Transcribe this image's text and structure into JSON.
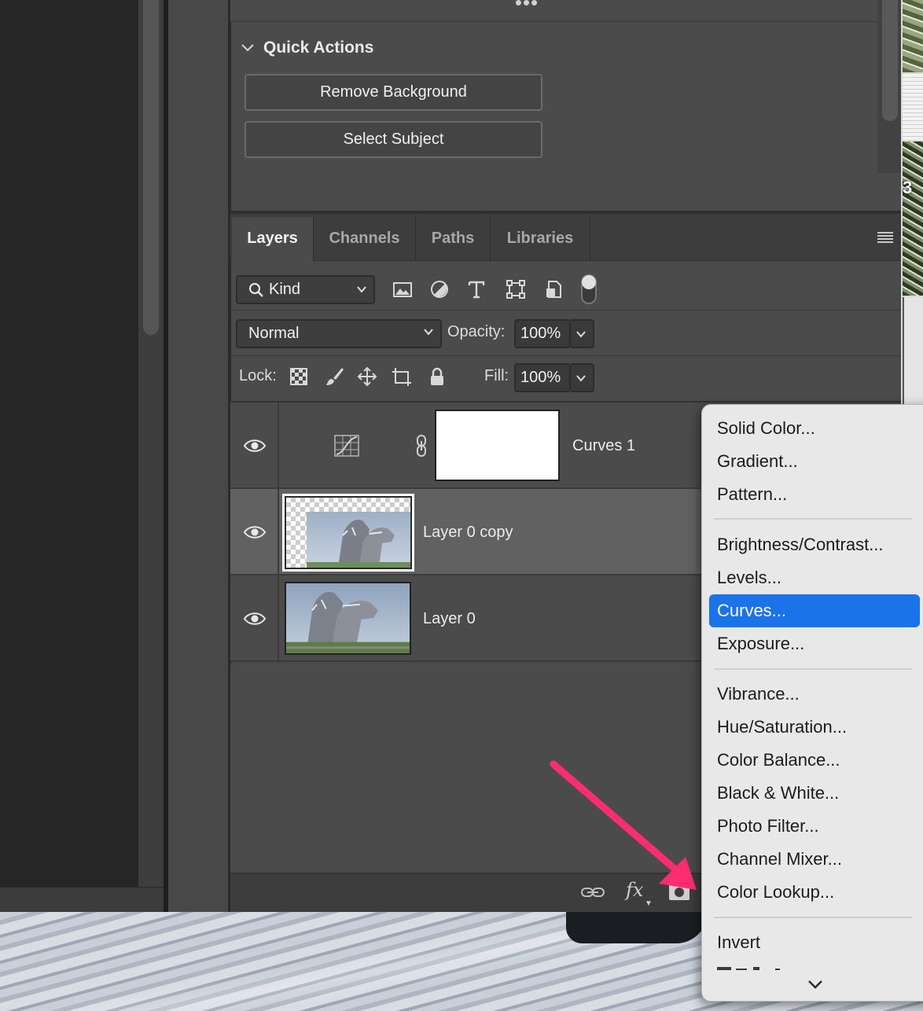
{
  "quick_actions": {
    "title": "Quick Actions",
    "buttons": [
      "Remove Background",
      "Select Subject"
    ]
  },
  "layers_panel": {
    "tabs": [
      "Layers",
      "Channels",
      "Paths",
      "Libraries"
    ],
    "active_tab": "Layers",
    "filter": {
      "kind_label": "Kind"
    },
    "blend_mode": "Normal",
    "opacity_label": "Opacity:",
    "opacity_value": "100%",
    "lock_label": "Lock:",
    "fill_label": "Fill:",
    "fill_value": "100%",
    "layers": [
      {
        "name": "Curves 1",
        "type": "adjustment",
        "visible": true
      },
      {
        "name": "Layer 0 copy",
        "type": "pixel",
        "visible": true,
        "selected": true
      },
      {
        "name": "Layer 0",
        "type": "pixel",
        "visible": true
      }
    ],
    "bottom_icons": [
      "link-icon",
      "fx-icon",
      "mask-icon"
    ]
  },
  "context_menu": {
    "items": [
      "Solid Color...",
      "Gradient...",
      "Pattern...",
      "Brightness/Contrast...",
      "Levels...",
      "Curves...",
      "Exposure...",
      "Vibrance...",
      "Hue/Saturation...",
      "Color Balance...",
      "Black & White...",
      "Photo Filter...",
      "Channel Mixer...",
      "Color Lookup...",
      "Invert"
    ],
    "highlighted": "Curves..."
  },
  "background_window": {
    "visible_number": "3"
  },
  "colors": {
    "panel": "#4b4b4b",
    "selected_row": "#616161",
    "menu_bg": "#e8e8e8",
    "menu_highlight": "#1a73e8",
    "arrow": "#ff2d6f"
  }
}
